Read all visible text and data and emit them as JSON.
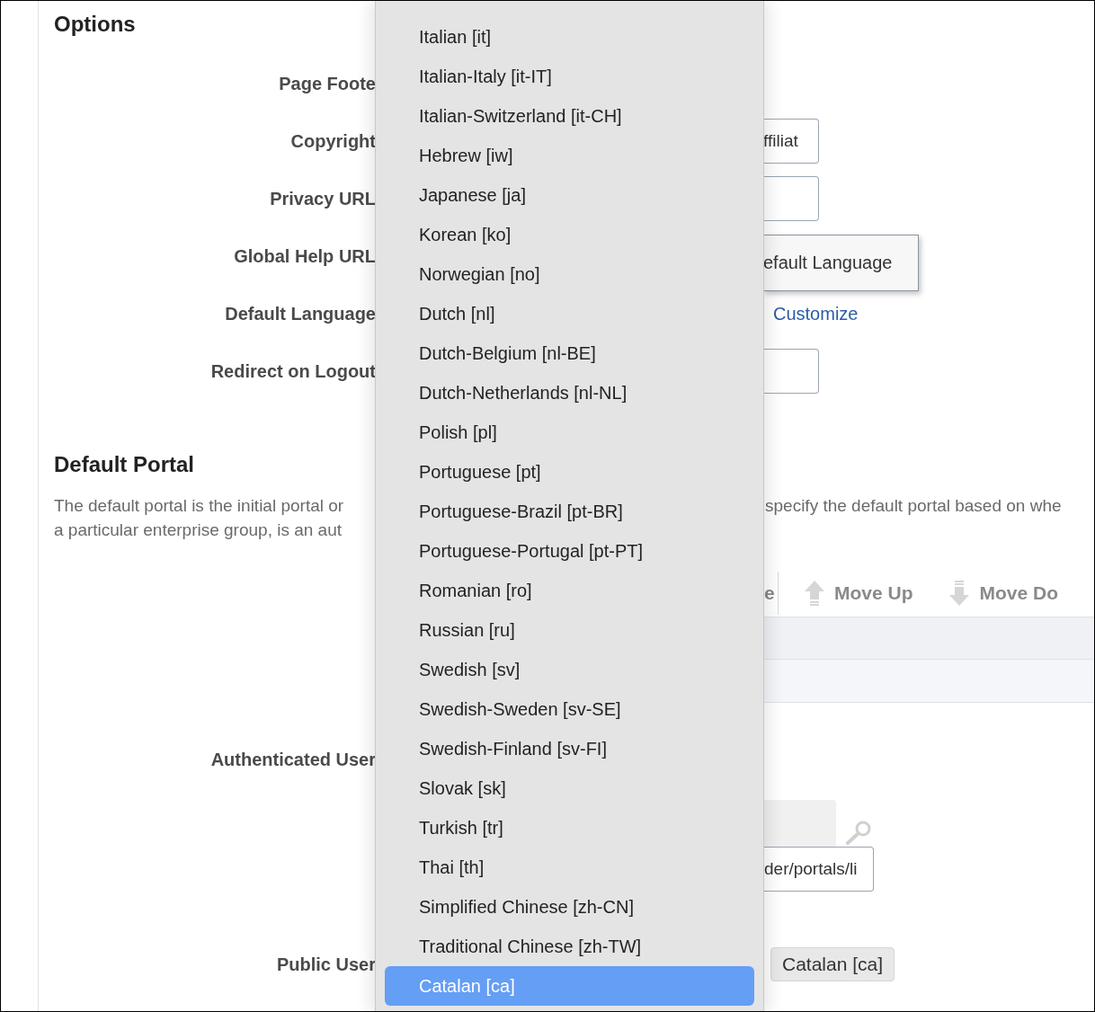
{
  "options": {
    "title": "Options",
    "rows": [
      {
        "label": "Page Foote",
        "kind": "none"
      },
      {
        "label": "Copyright",
        "kind": "field",
        "value": "ffiliat"
      },
      {
        "label": "Privacy URL",
        "kind": "field"
      },
      {
        "label": "Global Help URL",
        "kind": "button",
        "text": "efault Language"
      },
      {
        "label": "Default Language",
        "kind": "link",
        "text": "Customize"
      },
      {
        "label": "Redirect on Logout",
        "kind": "field"
      }
    ]
  },
  "default_portal": {
    "title": "Default Portal",
    "description_left": [
      "The default portal is the initial portal or",
      "a particular enterprise group, is an aut"
    ],
    "description_right": "specify the default portal based on whe",
    "toolbar": {
      "cut_label": "e",
      "buttons": [
        {
          "label": "Move Up",
          "kind": "up"
        },
        {
          "label": "Move Do",
          "kind": "down"
        }
      ]
    },
    "authenticated_users": {
      "label": "Authenticated User",
      "value": "der/portals/li"
    },
    "public_users": {
      "label": "Public User",
      "value": "Catalan [ca]"
    }
  },
  "language_menu": {
    "items": [
      {
        "label": "Italian [it]",
        "selected": false
      },
      {
        "label": "Italian-Italy [it-IT]",
        "selected": false
      },
      {
        "label": "Italian-Switzerland [it-CH]",
        "selected": false
      },
      {
        "label": "Hebrew [iw]",
        "selected": false
      },
      {
        "label": "Japanese [ja]",
        "selected": false
      },
      {
        "label": "Korean [ko]",
        "selected": false
      },
      {
        "label": "Norwegian [no]",
        "selected": false
      },
      {
        "label": "Dutch [nl]",
        "selected": false
      },
      {
        "label": "Dutch-Belgium [nl-BE]",
        "selected": false
      },
      {
        "label": "Dutch-Netherlands [nl-NL]",
        "selected": false
      },
      {
        "label": "Polish [pl]",
        "selected": false
      },
      {
        "label": "Portuguese [pt]",
        "selected": false
      },
      {
        "label": "Portuguese-Brazil [pt-BR]",
        "selected": false
      },
      {
        "label": "Portuguese-Portugal [pt-PT]",
        "selected": false
      },
      {
        "label": "Romanian [ro]",
        "selected": false
      },
      {
        "label": "Russian [ru]",
        "selected": false
      },
      {
        "label": "Swedish [sv]",
        "selected": false
      },
      {
        "label": "Swedish-Sweden [sv-SE]",
        "selected": false
      },
      {
        "label": "Swedish-Finland [sv-FI]",
        "selected": false
      },
      {
        "label": "Slovak [sk]",
        "selected": false
      },
      {
        "label": "Turkish [tr]",
        "selected": false
      },
      {
        "label": "Thai [th]",
        "selected": false
      },
      {
        "label": "Simplified Chinese [zh-CN]",
        "selected": false
      },
      {
        "label": "Traditional Chinese [zh-TW]",
        "selected": false
      },
      {
        "label": "Catalan [ca]",
        "selected": true
      }
    ]
  }
}
